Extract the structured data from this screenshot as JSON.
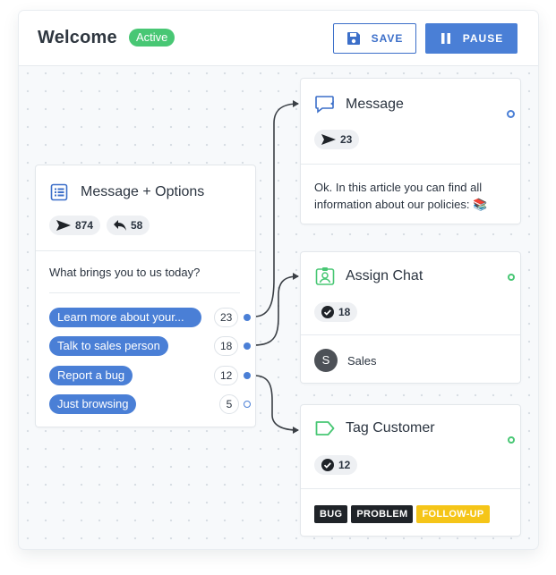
{
  "header": {
    "title": "Welcome",
    "status": "Active",
    "save_label": "SAVE",
    "pause_label": "PAUSE"
  },
  "options_card": {
    "title": "Message + Options",
    "sent_count": "874",
    "replied_count": "58",
    "prompt": "What brings you to us today?",
    "options": [
      {
        "label": "Learn more about your...",
        "count": "23"
      },
      {
        "label": "Talk to sales person",
        "count": "18"
      },
      {
        "label": "Report a bug",
        "count": "12"
      },
      {
        "label": "Just browsing",
        "count": "5"
      }
    ]
  },
  "message_card": {
    "title": "Message",
    "sent_count": "23",
    "body": "Ok. In this article you can find all information about our policies: 📚"
  },
  "assign_card": {
    "title": "Assign Chat",
    "done_count": "18",
    "avatar_initial": "S",
    "assignee": "Sales"
  },
  "tag_card": {
    "title": "Tag Customer",
    "done_count": "12",
    "tags": [
      "BUG",
      "PROBLEM",
      "FOLLOW-UP"
    ]
  },
  "colors": {
    "accent_blue": "#4a7fd6",
    "active_green": "#48c774",
    "tag_yellow": "#f5c518",
    "tag_dark": "#1f2328"
  },
  "icons": {
    "options_card": "list-icon",
    "message_card": "chat-bubble-icon",
    "assign_card": "person-badge-icon",
    "tag_card": "tag-icon",
    "save": "floppy-disk-icon",
    "pause": "pause-icon",
    "sent": "paper-plane-icon",
    "replied": "reply-arrow-icon",
    "done": "check-circle-icon"
  }
}
